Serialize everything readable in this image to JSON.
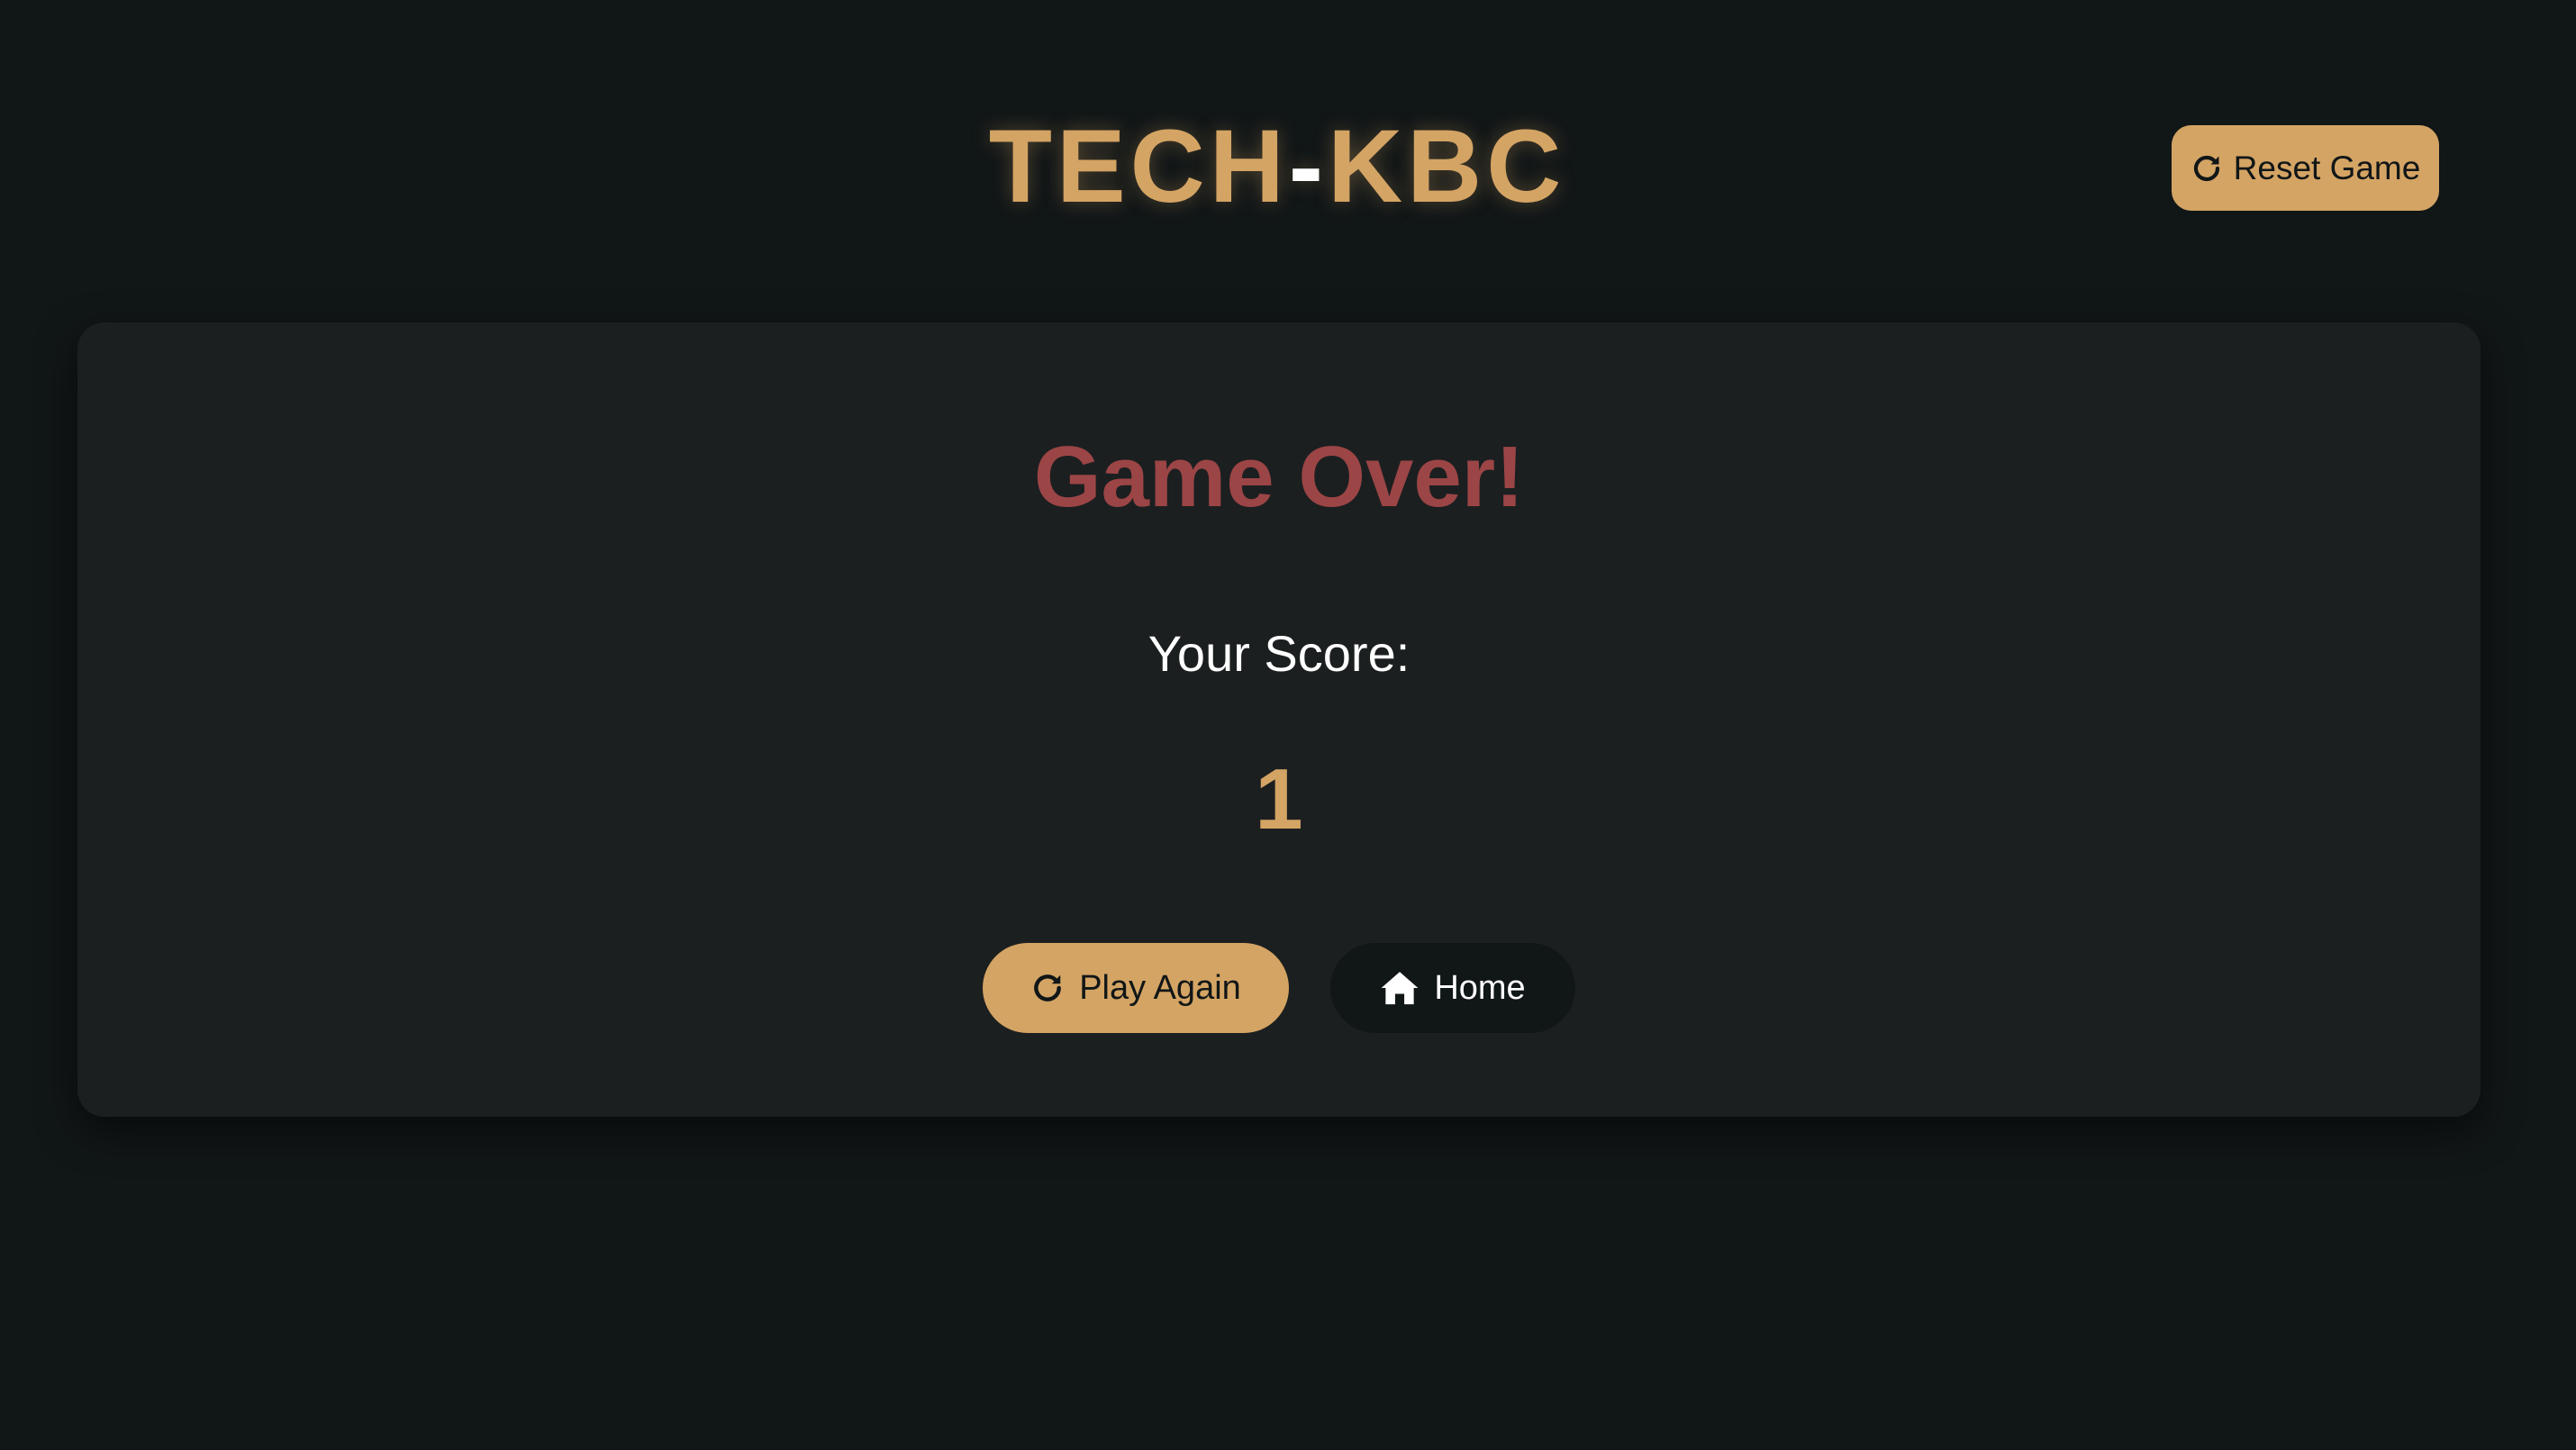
{
  "app": {
    "title_left": "TECH",
    "title_dash": "-",
    "title_right": "KBC"
  },
  "header": {
    "reset_label": "Reset Game",
    "reset_icon": "rotate-cw-icon"
  },
  "result": {
    "heading": "Game Over!",
    "score_label": "Your Score:",
    "score_value": "1"
  },
  "actions": {
    "play_again_label": "Play Again",
    "play_again_icon": "rotate-cw-icon",
    "home_label": "Home",
    "home_icon": "home-icon"
  },
  "colors": {
    "background": "#111617",
    "card": "#1c1f20",
    "accent": "#d4a464",
    "game_over": "#9c4546",
    "text": "#ffffff"
  }
}
